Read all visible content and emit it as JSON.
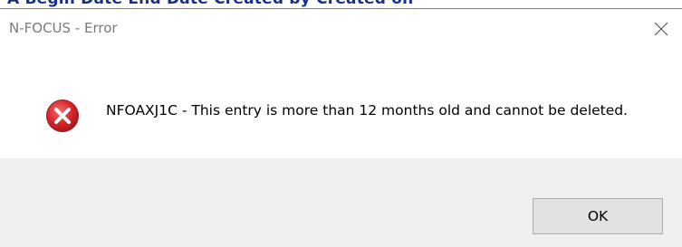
{
  "background_window": {
    "partial_text": "A   Begin Date      End Date        Created by      Created on"
  },
  "dialog": {
    "title": "N-FOCUS - Error",
    "message": "NFOAXJ1C - This entry is more than 12 months old and cannot be deleted.",
    "icon": "error-icon",
    "ok_label": "OK"
  },
  "colors": {
    "error_red": "#d9262a",
    "footer_bg": "#f0f0f0",
    "button_bg": "#e1e1e1",
    "title_text": "#7a7a7a",
    "underlay_text": "#1a2f8c"
  }
}
